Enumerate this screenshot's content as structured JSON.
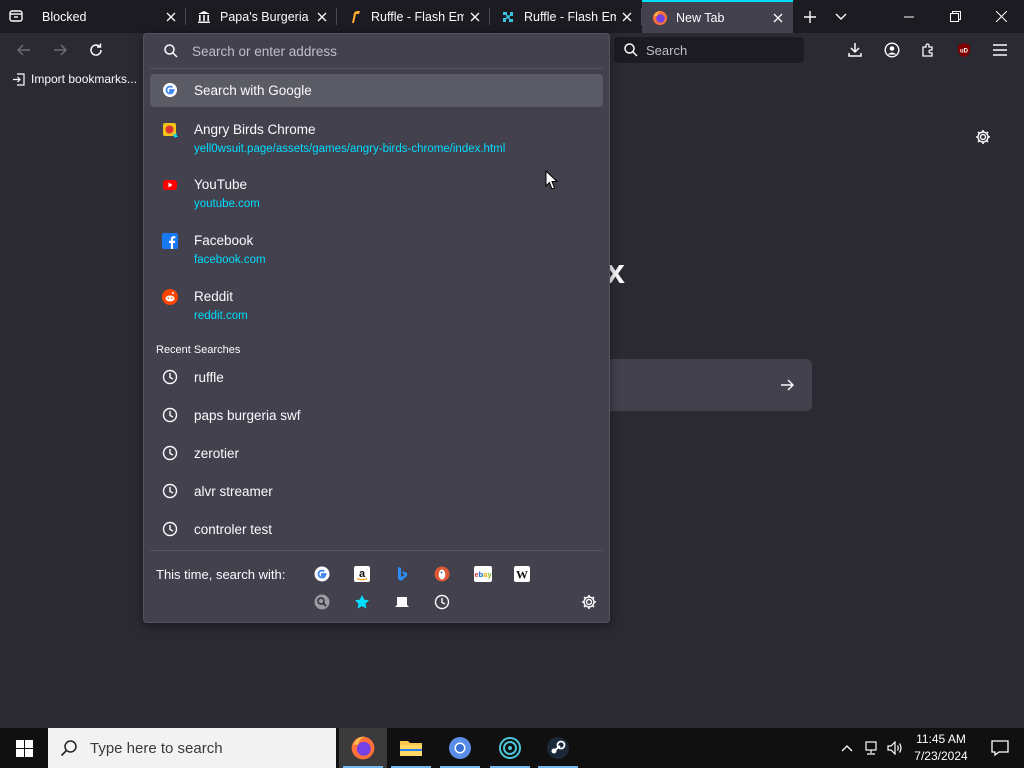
{
  "tabs": [
    {
      "title": "Blocked",
      "icon": "container-icon"
    },
    {
      "title": "Papa's Burgeria : F",
      "icon": "museum-icon"
    },
    {
      "title": "Ruffle - Flash Emu",
      "icon": "ruffle-icon"
    },
    {
      "title": "Ruffle - Flash Emu",
      "icon": "ruffle-puzzle-icon"
    },
    {
      "title": "New Tab",
      "icon": "firefox-icon",
      "active": true
    }
  ],
  "navbar": {
    "search_placeholder": "Search"
  },
  "bookmarks": {
    "import_label": "Import bookmarks..."
  },
  "urlbar": {
    "placeholder": "Search or enter address",
    "search_with_google": "Search with Google",
    "suggestions": [
      {
        "title": "Angry Birds Chrome",
        "url": "yell0wsuit.page/assets/games/angry-birds-chrome/index.html",
        "icon": "angry-birds-icon"
      },
      {
        "title": "YouTube",
        "url": "youtube.com",
        "icon": "youtube-icon"
      },
      {
        "title": "Facebook",
        "url": "facebook.com",
        "icon": "facebook-icon"
      },
      {
        "title": "Reddit",
        "url": "reddit.com",
        "icon": "reddit-icon"
      }
    ],
    "recent_heading": "Recent Searches",
    "recent": [
      "ruffle",
      "paps burgeria swf",
      "zerotier",
      "alvr streamer",
      "controler test"
    ],
    "search_with_label": "This time, search with:",
    "engines": [
      "google",
      "amazon",
      "bing",
      "duckduckgo",
      "ebay",
      "wikipedia"
    ],
    "modes": [
      "search-tabs",
      "bookmarks",
      "tabs",
      "history"
    ]
  },
  "content": {
    "logo_fragment": "x"
  },
  "taskbar": {
    "search_placeholder": "Type here to search",
    "time": "11:45 AM",
    "date": "7/23/2024"
  },
  "colors": {
    "accent": "#00ddff",
    "panel": "#42414d",
    "toolbar": "#2b2a33",
    "tabstrip": "#1c1b22"
  }
}
